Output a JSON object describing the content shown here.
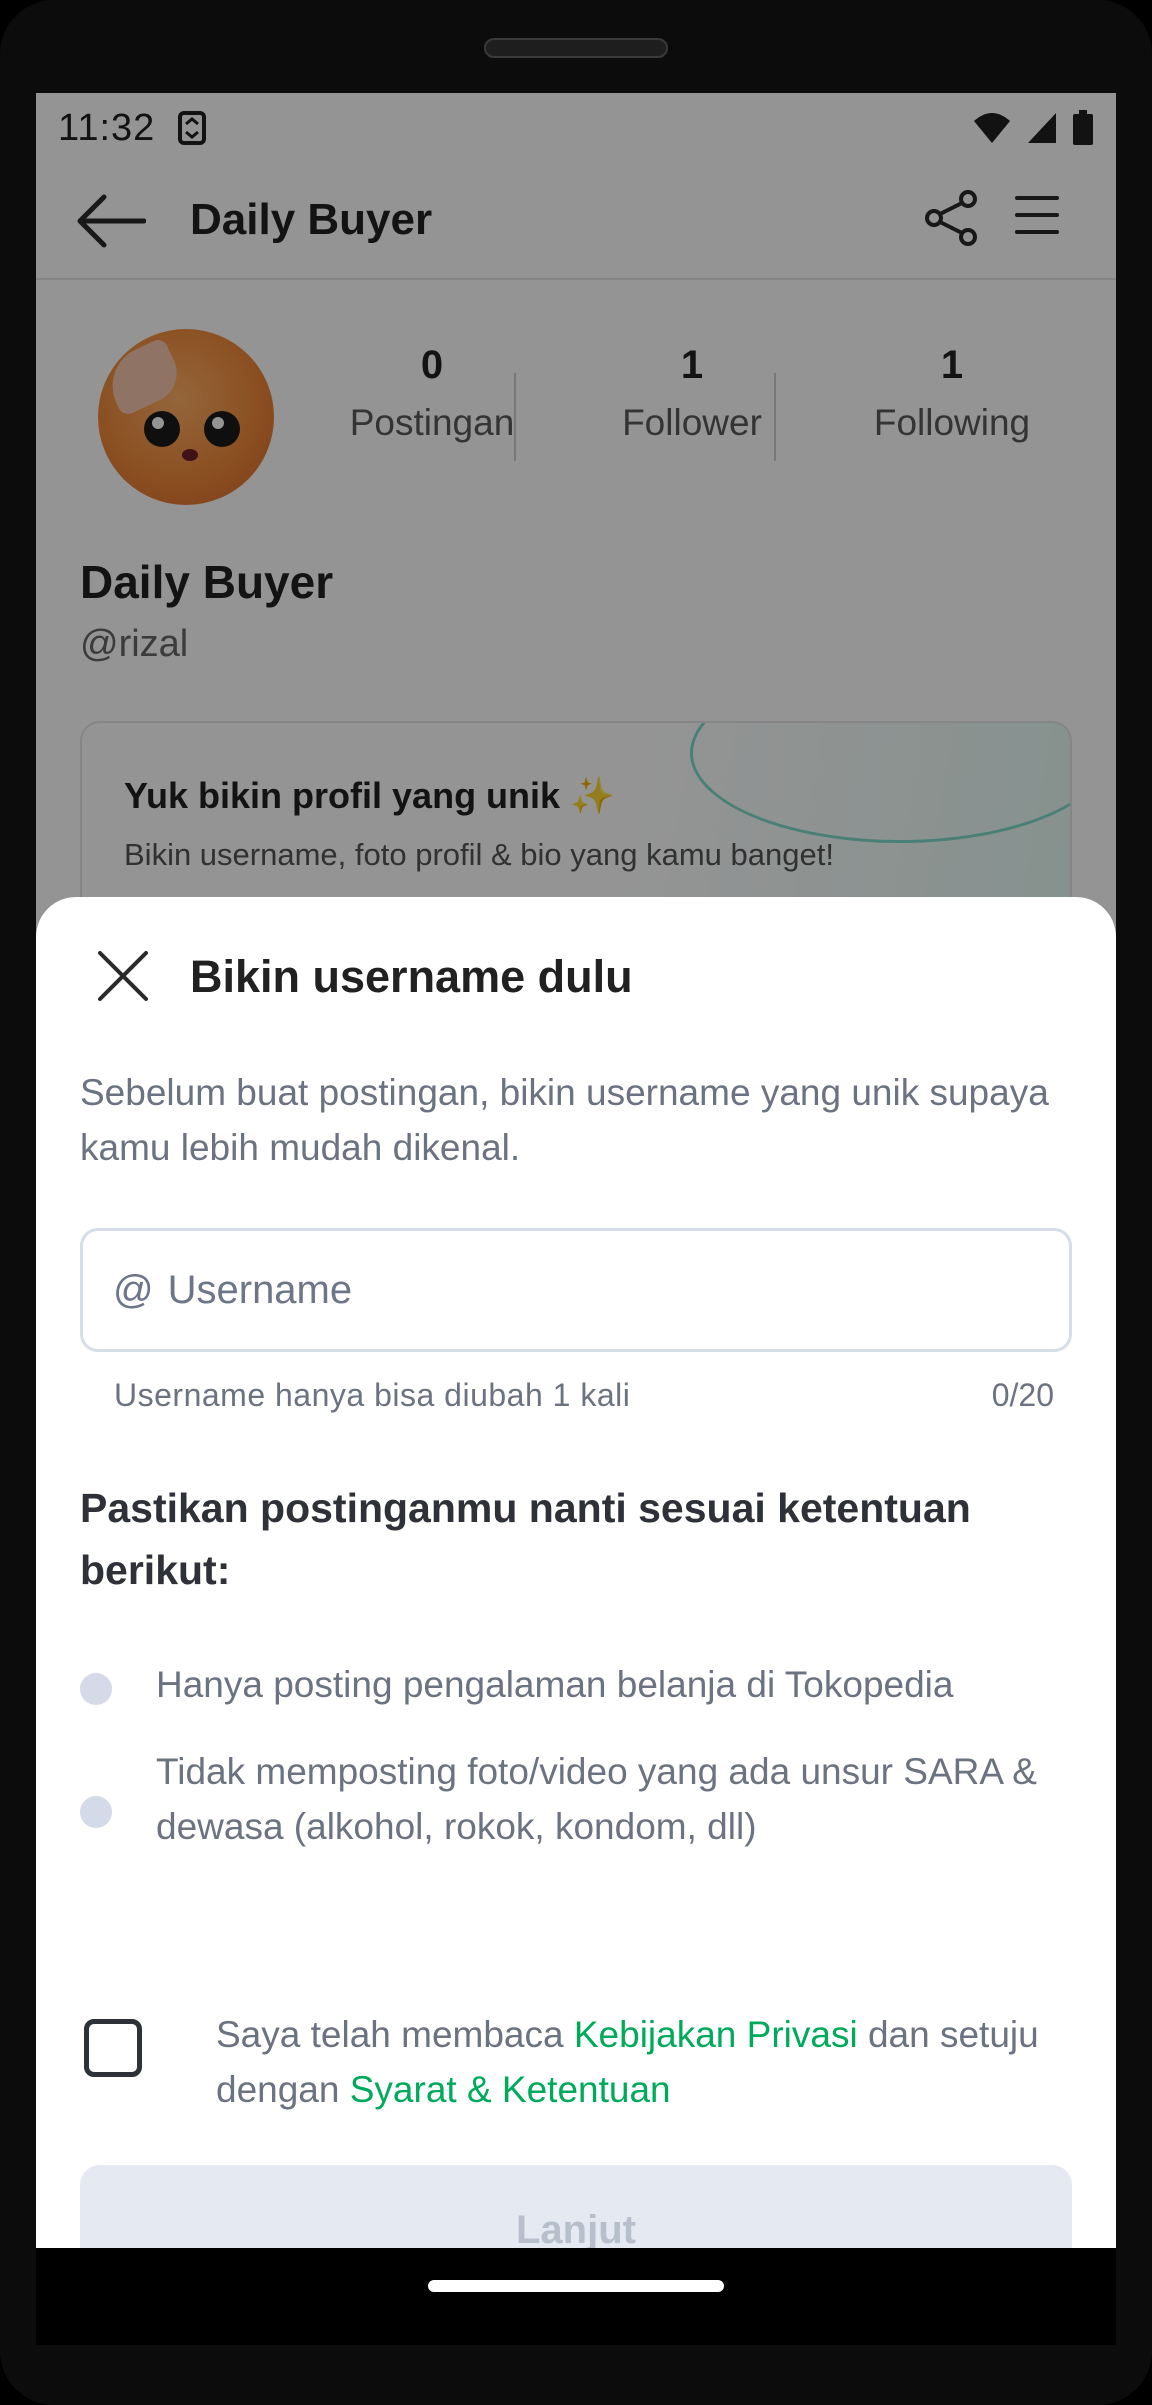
{
  "status_bar": {
    "time": "11:32"
  },
  "header": {
    "title": "Daily Buyer"
  },
  "profile": {
    "stats": [
      {
        "value": "0",
        "label": "Postingan"
      },
      {
        "value": "1",
        "label": "Follower"
      },
      {
        "value": "1",
        "label": "Following"
      }
    ],
    "name": "Daily Buyer",
    "handle": "@rizal"
  },
  "promo": {
    "title": "Yuk bikin profil yang unik ✨",
    "subtitle": "Bikin username, foto profil & bio yang kamu banget!"
  },
  "sheet": {
    "title": "Bikin username dulu",
    "description": "Sebelum buat postingan, bikin username yang unik supaya kamu lebih mudah dikenal.",
    "username_prefix": "@",
    "username_placeholder": "Username",
    "username_value": "",
    "helper": "Username hanya bisa diubah 1 kali",
    "counter": "0/20",
    "rules_title": "Pastikan postinganmu nanti sesuai ketentuan berikut:",
    "rules": [
      "Hanya posting pengalaman belanja di Tokopedia",
      "Tidak memposting foto/video yang ada unsur SARA & dewasa (alkohol, rokok, kondom, dll)"
    ],
    "agreement": {
      "text_1": "Saya telah membaca ",
      "link_1": "Kebijakan Privasi",
      "text_2": " dan setuju dengan ",
      "link_2": "Syarat & Ketentuan",
      "checked": false
    },
    "button_label": "Lanjut"
  },
  "colors": {
    "link_green": "#00aa5b",
    "disabled_button_bg": "#e4e9f2",
    "disabled_button_text": "#b7bfcc"
  }
}
